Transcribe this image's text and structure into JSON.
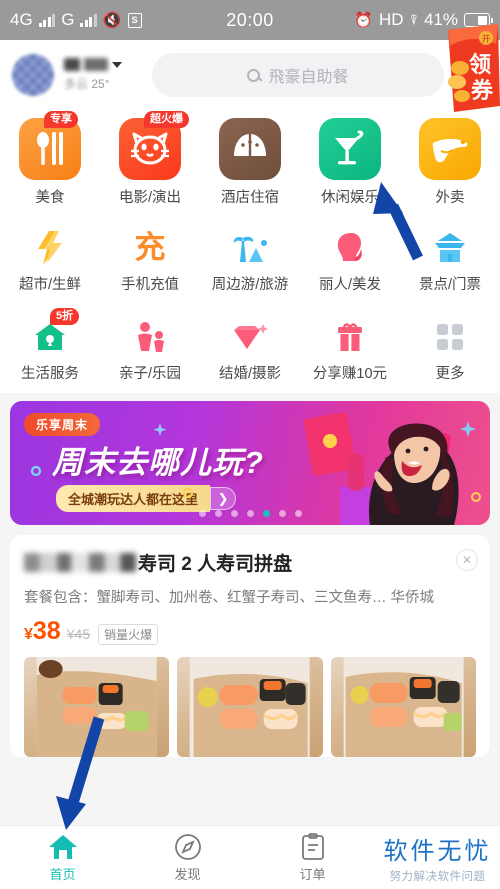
{
  "statusbar": {
    "net1": "4G",
    "net2": "G",
    "speaker_icon": "speaker-mute-icon",
    "sbox_label": "S",
    "time": "20:00",
    "alarm_icon": "alarm-clock-icon",
    "hd": "HD",
    "wifi_icon": "wifi-icon",
    "battery_pct": "41%"
  },
  "header": {
    "avatar_icon": "user-avatar-blurred",
    "location_name_blurred": "",
    "chevron_icon": "chevron-down-icon",
    "weather_condition": "多云",
    "weather_temp": "25°",
    "search": {
      "icon": "search-icon",
      "placeholder": "飛豪自助餐",
      "value": ""
    },
    "plus_icon": "plus-icon",
    "plus_badge": "new-dot-badge"
  },
  "grid": {
    "rows": [
      [
        {
          "label": "美食",
          "icon": "utensils-icon",
          "badge": "专享",
          "color": "#f98c27"
        },
        {
          "label": "电影/演出",
          "icon": "cat-face-icon",
          "badge": "超火爆",
          "color": "#fb4f24"
        },
        {
          "label": "酒店住宿",
          "icon": "hotel-fan-icon",
          "badge": "",
          "color": "#7c5a46"
        },
        {
          "label": "休闲娱乐",
          "icon": "cocktail-icon",
          "badge": "",
          "color": "#14c08a"
        },
        {
          "label": "外卖",
          "icon": "delivery-scooter-icon",
          "badge": "",
          "color": "#fcb20b"
        }
      ],
      [
        {
          "label": "超市/生鲜",
          "icon": "lightning-icon",
          "badge": "",
          "color": "#fdbb2d"
        },
        {
          "label": "手机充值",
          "icon": "recharge-char-icon",
          "badge": "",
          "color": "#fb8c2a"
        },
        {
          "label": "周边游/旅游",
          "icon": "palm-tree-icon",
          "badge": "",
          "color": "#3bb7ef"
        },
        {
          "label": "丽人/美发",
          "icon": "beauty-head-icon",
          "badge": "",
          "color": "#fb5c7a"
        },
        {
          "label": "景点/门票",
          "icon": "pagoda-icon",
          "badge": "",
          "color": "#3bb7ef"
        }
      ],
      [
        {
          "label": "生活服务",
          "icon": "home-pin-icon",
          "badge": "5折",
          "color": "#14c08a"
        },
        {
          "label": "亲子/乐园",
          "icon": "parent-child-icon",
          "badge": "",
          "color": "#fb5c7a"
        },
        {
          "label": "结婚/摄影",
          "icon": "diamond-icon",
          "badge": "",
          "color": "#fb5c7a"
        },
        {
          "label": "分享赚10元",
          "icon": "gift-icon",
          "badge": "",
          "color": "#fb5c7a"
        },
        {
          "label": "更多",
          "icon": "grid-more-icon",
          "badge": "",
          "color": "#c8cdd4"
        }
      ]
    ]
  },
  "banner": {
    "tag": "乐享周末",
    "title": "周末去哪儿玩?",
    "subtitle": "全城潮玩达人都在这里",
    "arrow_icon": "chevron-right-icon",
    "dots_total": 7,
    "dots_active_index": 4,
    "accent": "#12c4bd"
  },
  "deal_card": {
    "title_blurred_prefix": "",
    "title": "寿司 2 人寿司拼盘",
    "close_icon": "close-icon",
    "description": "套餐包含：蟹脚寿司、加州卷、红蟹子寿司、三文鱼寿… 华侨城",
    "price_now": "38",
    "price_now_symbol": "¥",
    "price_old": "¥45",
    "sales_tag": "销量火爆",
    "photos": [
      {
        "name": "sushi-platter-photo-1"
      },
      {
        "name": "sushi-platter-photo-2"
      },
      {
        "name": "sushi-platter-photo-3"
      }
    ],
    "coupon": {
      "icon": "coupon-envelope-icon",
      "text": "领券"
    }
  },
  "annotations": {
    "arrow_to_takeout": "blue-arrow-pointing-to-takeout-icon",
    "arrow_to_home_tab": "blue-arrow-pointing-to-home-tab"
  },
  "tabbar": {
    "items": [
      {
        "label": "首页",
        "icon": "home-icon",
        "active": true
      },
      {
        "label": "发现",
        "icon": "compass-icon",
        "active": false
      },
      {
        "label": "订单",
        "icon": "order-clipboard-icon",
        "active": false
      }
    ],
    "active_color": "#13bdb4",
    "watermark_main": "软件无忧",
    "watermark_sub": "努力解决软件问题"
  }
}
